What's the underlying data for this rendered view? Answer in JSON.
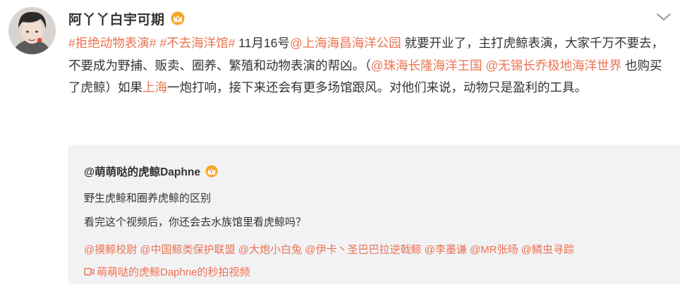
{
  "post": {
    "author": "阿丫丫白宇可期",
    "segments": [
      {
        "text": "#拒绝动物表演#",
        "link": true
      },
      {
        "text": " ",
        "link": false
      },
      {
        "text": "#不去海洋馆#",
        "link": true
      },
      {
        "text": " 11月16号",
        "link": false
      },
      {
        "text": "@上海海昌海洋公园",
        "link": true
      },
      {
        "text": " 就要开业了，主打虎鲸表演，大家千万不要去，不要成为野捕、贩卖、圈养、繁殖和动物表演的帮凶。（",
        "link": false
      },
      {
        "text": "@珠海长隆海洋王国",
        "link": true
      },
      {
        "text": " ",
        "link": false
      },
      {
        "text": "@无锡长乔极地海洋世界",
        "link": true
      },
      {
        "text": " 也购买了虎鲸）如果",
        "link": false
      },
      {
        "text": "上海",
        "link": true
      },
      {
        "text": "一炮打响，接下来还会有更多场馆跟风。对他们来说，动物只是盈利的工具。",
        "link": false
      }
    ]
  },
  "repost": {
    "author": "@萌萌哒的虎鲸Daphne",
    "line1": "野生虎鲸和圈养虎鲸的区别",
    "line2": "看完这个视频后，你还会去水族馆里看虎鲸吗？",
    "mentions": [
      "@摸鲸校尉",
      "@中国鲸类保护联盟",
      "@大炮小白兔",
      "@伊卡丶圣巴巴拉逆戟鲸",
      "@李墨谦",
      "@MR张旸",
      "@鳞虫寻踪"
    ],
    "video_label": "萌萌哒的虎鲸Daphne的秒拍视频"
  },
  "icons": {
    "crown": "crown-icon",
    "chevron": "chevron-down-icon",
    "video": "video-icon"
  },
  "colors": {
    "link": "#eb7350",
    "text": "#333333",
    "repost_bg": "#f2f2f5",
    "crown": "#f5a623"
  }
}
